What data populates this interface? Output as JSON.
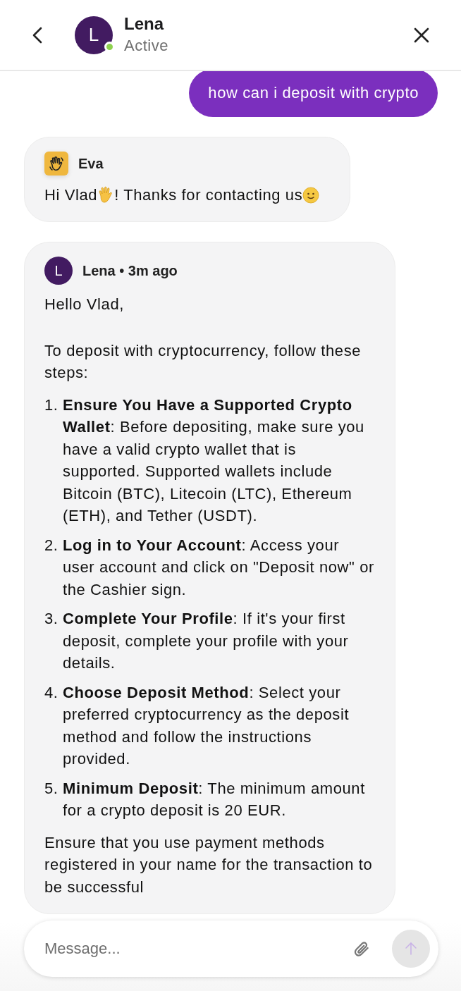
{
  "header": {
    "name": "Lena",
    "status": "Active",
    "avatar_letter": "L",
    "online": true
  },
  "messages": [
    {
      "kind": "user",
      "text": "how can i deposit with crypto"
    },
    {
      "kind": "bot",
      "sender": "Eva",
      "parts": [
        {
          "kind": "text",
          "text": "Hi Vlad"
        },
        {
          "kind": "hand"
        },
        {
          "kind": "text",
          "text": "! Thanks for contacting us"
        },
        {
          "kind": "smile"
        }
      ]
    },
    {
      "kind": "agent",
      "sender": "Lena • 3m ago",
      "avatar_letter": "L",
      "blocks": [
        {
          "kind": "paragraph",
          "text": "Hello Vlad,"
        },
        {
          "kind": "paragraph",
          "text": "To deposit with cryptocurrency, follow these steps:"
        },
        {
          "kind": "list",
          "items": [
            {
              "number": "1.",
              "text": "**Ensure You Have a Supported Crypto Wallet**: Before depositing, make sure you have a valid crypto wallet that is supported. Supported wallets include Bitcoin (BTC), Litecoin (LTC), Ethereum (ETH), and Tether (USDT)."
            },
            {
              "number": "2.",
              "text": "**Log in to Your Account**: Access your user account and click on \"Deposit now\" or the Cashier sign."
            },
            {
              "number": "3.",
              "text": "**Complete Your Profile**: If it's your first deposit, complete your profile with your details."
            },
            {
              "number": "4.",
              "text": "**Choose Deposit Method**: Select your preferred cryptocurrency as the deposit method and follow the instructions provided."
            },
            {
              "number": "5.",
              "text": "**Minimum Deposit**: The minimum amount for a crypto deposit is 20 EUR."
            }
          ]
        },
        {
          "kind": "paragraph",
          "text": "Ensure that you use payment methods registered in your name for the transaction to be successful"
        }
      ]
    }
  ],
  "composer": {
    "placeholder": "Message...",
    "send_disabled": true
  }
}
